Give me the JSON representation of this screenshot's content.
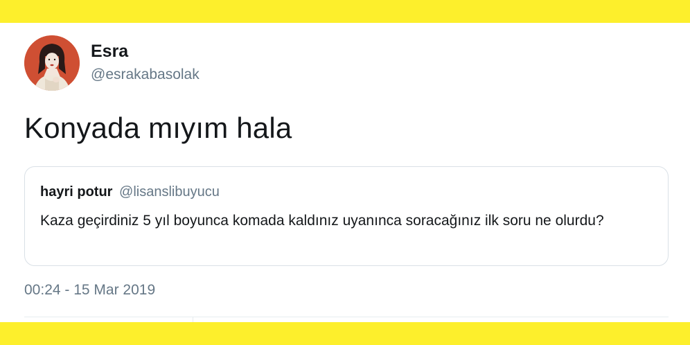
{
  "colors": {
    "band": "#fdef2c",
    "text_primary": "#14171a",
    "text_secondary": "#657786",
    "border": "#d9e0e6"
  },
  "author": {
    "name": "Esra",
    "handle": "@esrakabasolak",
    "avatar_icon": "profile-illustration-avatar"
  },
  "tweet": {
    "text": "Konyada mıyım hala",
    "timestamp": "00:24 - 15 Mar 2019"
  },
  "quoted_tweet": {
    "name": "hayri potur",
    "handle": "@lisanslibuyucu",
    "text": "Kaza geçirdiniz 5 yıl boyunca komada kaldınız uyanınca soracağınız ilk soru ne olurdu?"
  }
}
